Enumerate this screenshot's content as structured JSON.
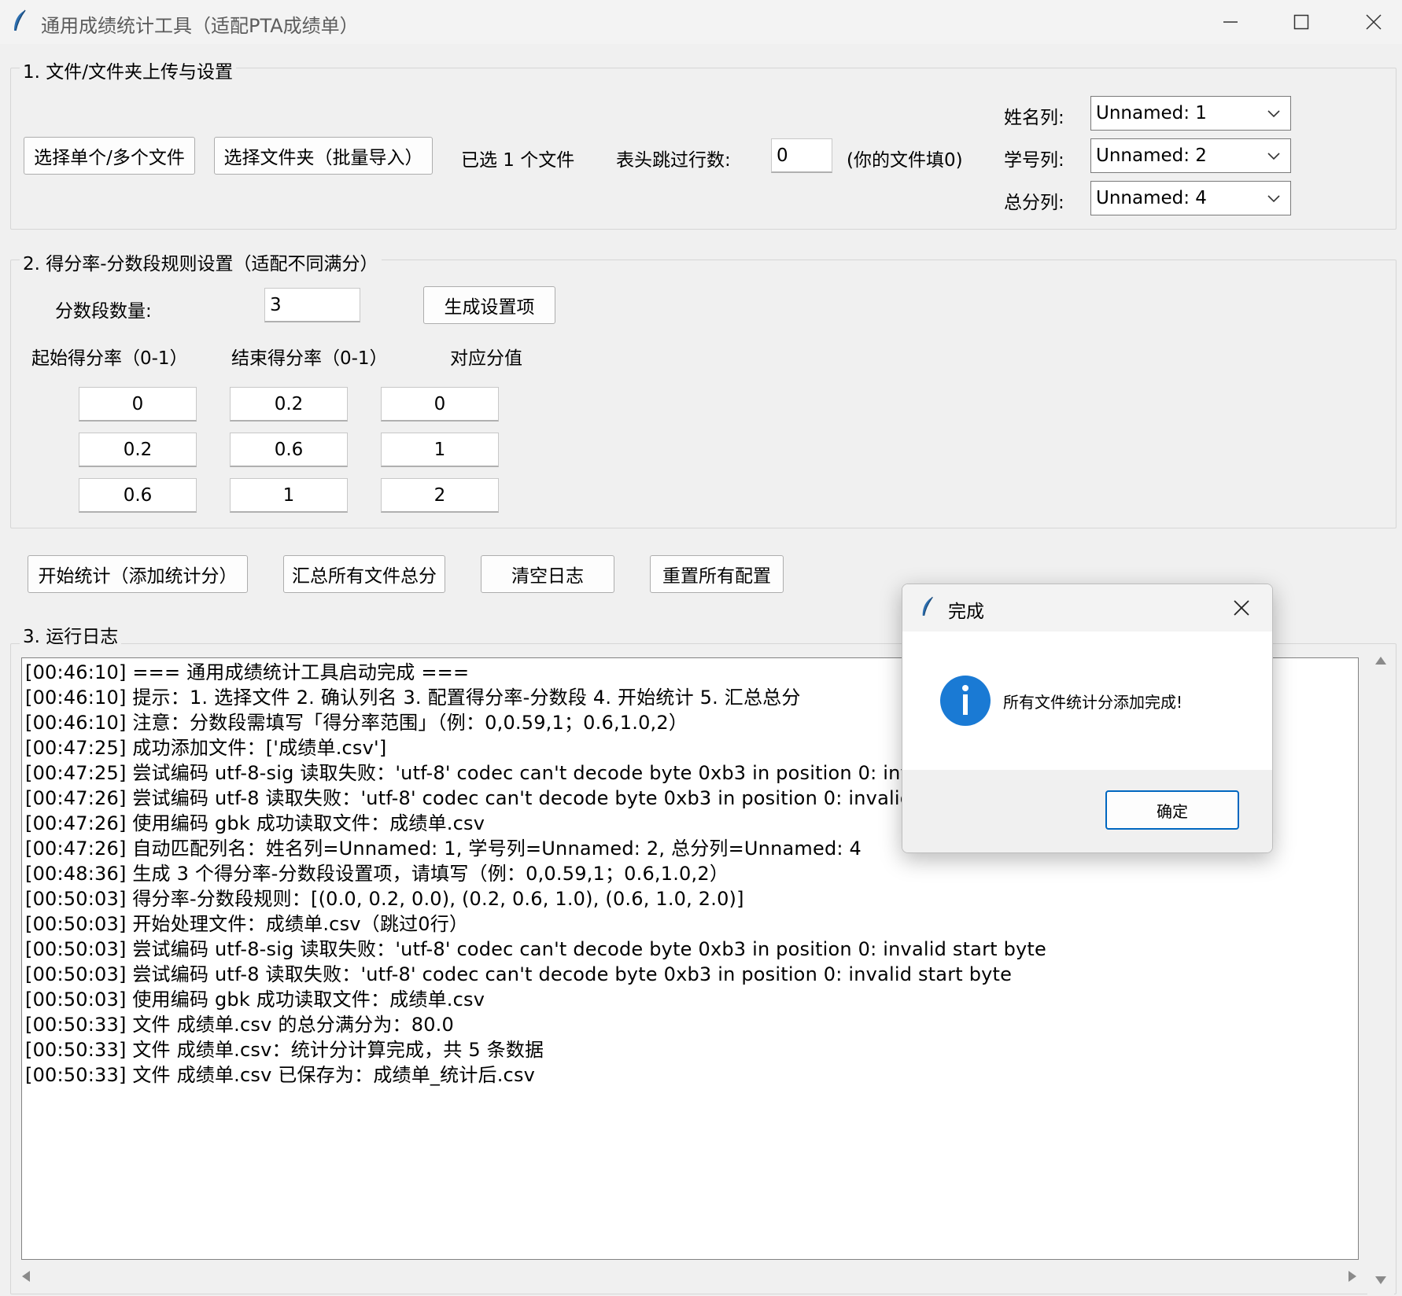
{
  "window": {
    "title": "通用成绩统计工具（适配PTA成绩单）",
    "icons": {
      "app": "feather-icon",
      "minimize": "minimize-icon",
      "maximize": "maximize-icon",
      "close": "close-icon"
    }
  },
  "section1": {
    "legend": "1. 文件/文件夹上传与设置",
    "select_files_button": "选择单个/多个文件",
    "select_folder_button": "选择文件夹（批量导入）",
    "selected_status": "已选 1 个文件",
    "skip_rows_label": "表头跳过行数:",
    "skip_rows_value": "0",
    "skip_rows_hint": "(你的文件填0)",
    "name_col_label": "姓名列:",
    "name_col_value": "Unnamed: 1",
    "id_col_label": "学号列:",
    "id_col_value": "Unnamed: 2",
    "total_col_label": "总分列:",
    "total_col_value": "Unnamed: 4"
  },
  "section2": {
    "legend": "2. 得分率-分数段规则设置（适配不同满分）",
    "segment_count_label": "分数段数量:",
    "segment_count_value": "3",
    "generate_button": "生成设置项",
    "col_headers": [
      "起始得分率（0-1）",
      "结束得分率（0-1）",
      "对应分值"
    ],
    "rows": [
      {
        "start": "0",
        "end": "0.2",
        "score": "0"
      },
      {
        "start": "0.2",
        "end": "0.6",
        "score": "1"
      },
      {
        "start": "0.6",
        "end": "1",
        "score": "2"
      }
    ]
  },
  "actions": {
    "start_button": "开始统计（添加统计分）",
    "summarize_button": "汇总所有文件总分",
    "clear_log_button": "清空日志",
    "reset_button": "重置所有配置"
  },
  "section3": {
    "legend": "3. 运行日志",
    "log_lines": [
      "[00:46:10] === 通用成绩统计工具启动完成 ===",
      "[00:46:10] 提示：1. 选择文件 2. 确认列名 3. 配置得分率-分数段 4. 开始统计 5. 汇总总分",
      "[00:46:10] 注意：分数段需填写「得分率范围」（例：0,0.59,1；0.6,1.0,2）",
      "[00:47:25] 成功添加文件：['成绩单.csv']",
      "[00:47:25] 尝试编码 utf-8-sig 读取失败：'utf-8' codec can't decode byte 0xb3 in position 0: invalid start byte",
      "[00:47:26] 尝试编码 utf-8 读取失败：'utf-8' codec can't decode byte 0xb3 in position 0: invalid start byte",
      "[00:47:26] 使用编码 gbk 成功读取文件：成绩单.csv",
      "[00:47:26] 自动匹配列名：姓名列=Unnamed: 1, 学号列=Unnamed: 2, 总分列=Unnamed: 4",
      "[00:48:36] 生成 3 个得分率-分数段设置项，请填写（例：0,0.59,1；0.6,1.0,2）",
      "[00:50:03] 得分率-分数段规则：[(0.0, 0.2, 0.0), (0.2, 0.6, 1.0), (0.6, 1.0, 2.0)]",
      "[00:50:03] 开始处理文件：成绩单.csv（跳过0行）",
      "[00:50:03] 尝试编码 utf-8-sig 读取失败：'utf-8' codec can't decode byte 0xb3 in position 0: invalid start byte",
      "[00:50:03] 尝试编码 utf-8 读取失败：'utf-8' codec can't decode byte 0xb3 in position 0: invalid start byte",
      "[00:50:03] 使用编码 gbk 成功读取文件：成绩单.csv",
      "[00:50:33] 文件 成绩单.csv 的总分满分为：80.0",
      "[00:50:33] 文件 成绩单.csv：统计分计算完成，共 5 条数据",
      "[00:50:33] 文件 成绩单.csv 已保存为：成绩单_统计后.csv"
    ]
  },
  "dialog": {
    "title": "完成",
    "message": "所有文件统计分添加完成!",
    "ok_button": "确定",
    "icon": "info-icon"
  }
}
